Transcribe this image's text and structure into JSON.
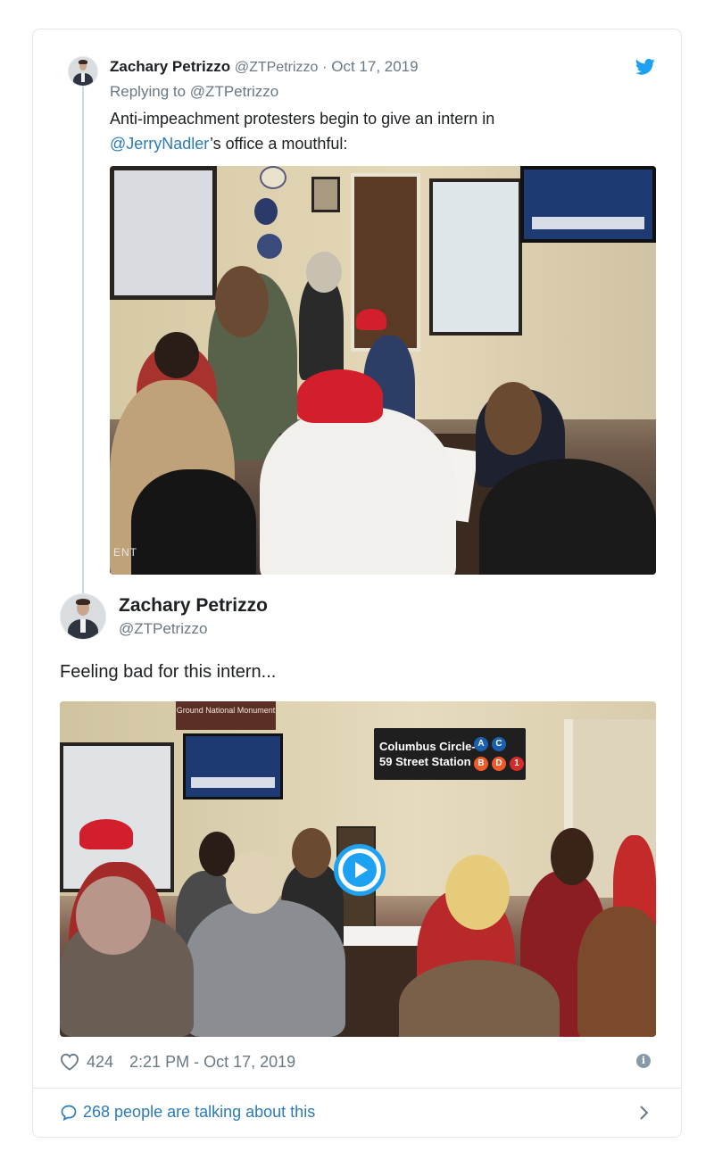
{
  "tweet": {
    "author_name": "Zachary Petrizzo",
    "author_handle": "@ZTPetrizzo",
    "separator": "·",
    "date": "Oct 17, 2019",
    "replying_prefix": "Replying to",
    "replying_to": "@ZTPetrizzo",
    "text_before": "Anti-impeachment protesters begin to give an intern in ",
    "mention": "@JerryNadler",
    "text_after": "’s office a mouthful:",
    "photo_watermark": "ENT"
  },
  "quoted": {
    "author_name": "Zachary Petrizzo",
    "author_handle": "@ZTPetrizzo",
    "text": "Feeling bad for this intern...",
    "video_sign_line1": "Columbus Circle-",
    "video_sign_line2": "59 Street Station",
    "video_badges": [
      "A",
      "C",
      "B",
      "D",
      "1"
    ],
    "video_plaque": "Ground National Monument"
  },
  "footer": {
    "likes": "424",
    "timestamp": "2:21 PM - Oct 17, 2019",
    "info_glyph": "i",
    "talking": "268 people are talking about this"
  },
  "colors": {
    "link_blue": "#2b7bb9",
    "twitter_blue": "#1da1f2",
    "muted_gray": "#697882",
    "border": "#e1e8ed"
  },
  "icons": [
    "twitter-bird-icon",
    "heart-icon",
    "info-icon",
    "comment-bubble-icon",
    "chevron-right-icon",
    "play-icon"
  ]
}
